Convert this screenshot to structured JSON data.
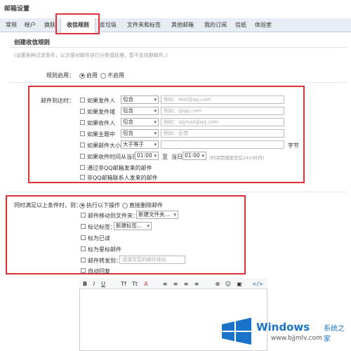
{
  "window_title": "邮箱设置",
  "tabs": [
    "常规",
    "帐户",
    "换肤",
    "收信规则",
    "反垃圾",
    "文件夹和标签",
    "其他邮箱",
    "我的订阅",
    "信纸",
    "体验室"
  ],
  "section_title": "创建收信规则",
  "section_desc": "(设置各种过滤条件，以方便对邮件进行分类或处理，暂不支持群邮件。)",
  "rule_enable": {
    "label": "规则启用：",
    "on": "启用",
    "off": "不启用",
    "selected": "on"
  },
  "arrival": {
    "label": "邮件到达时：",
    "rows": [
      {
        "check": "如果发件人",
        "select": "包含",
        "placeholder": "例如：test@qq.com"
      },
      {
        "check": "如果发件域",
        "select": "包含",
        "placeholder": "例如：@qq.com"
      },
      {
        "check": "如果收件人",
        "select": "包含",
        "placeholder": "例如：qqmail@qq.com"
      },
      {
        "check": "如果主题中",
        "select": "包含",
        "placeholder": "例如：反馈"
      }
    ],
    "size_row": {
      "check": "如果邮件大小",
      "select": "大于等于",
      "unit": "字节"
    },
    "time_row": {
      "check": "如果收件时间从当日",
      "from": "01:00",
      "to_label": "至",
      "day_label": "当日",
      "to": "01:00",
      "note": "(时间范围限定在24小时内)"
    },
    "extra": [
      "通过非QQ邮箱发来的邮件",
      "非QQ邮箱联系人发来的邮件"
    ]
  },
  "actions": {
    "label": "同时满足以上条件时，则：",
    "mode_on": "执行以下操作",
    "mode_delete": "直接删除邮件",
    "move": {
      "check": "邮件移动到文件夹：",
      "select": "新建文件夹..."
    },
    "tag": {
      "check": "标记标签：",
      "select": "新建标签..."
    },
    "read": "标为已读",
    "star": "标为星标邮件",
    "forward": {
      "check": "邮件转发到：",
      "placeholder": "请填写您的邮件地址"
    },
    "auto_reply": "自动回复"
  },
  "editor_toolbar": [
    "B",
    "I",
    "U",
    "Tf",
    "Tt",
    "A",
    "≡",
    "≡",
    "≡",
    "≡",
    "⊕",
    "☺",
    "▣",
    "</>"
  ],
  "watermark": {
    "brand": "Windows",
    "cn": "系统之家",
    "url": "www.bjjmlv.com"
  },
  "colors": {
    "highlight": "#e0303a",
    "tab_bg": "#e8edf3",
    "brand": "#1a73c8"
  }
}
